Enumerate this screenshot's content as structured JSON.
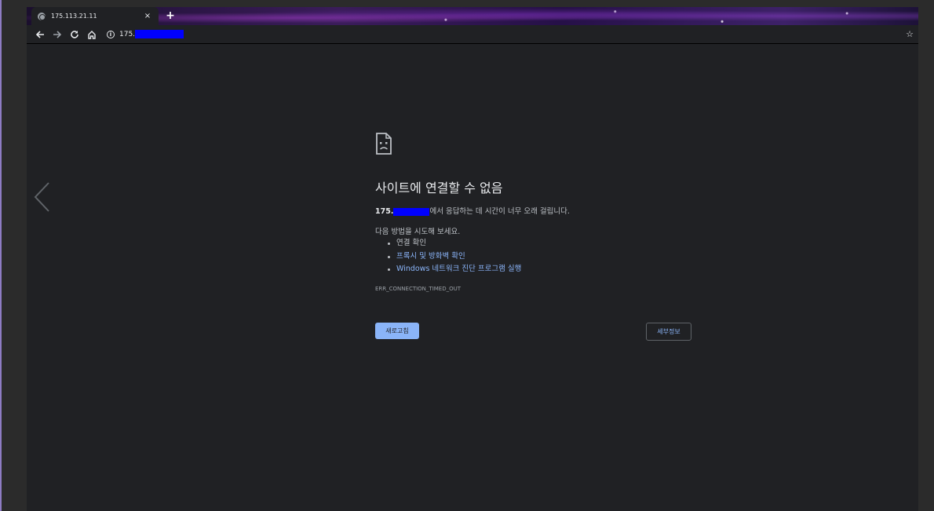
{
  "tab": {
    "title": "175.113.21.11",
    "close_glyph": "×",
    "favicon": "globe-icon"
  },
  "new_tab_glyph": "+",
  "toolbar": {
    "back_icon": "back-arrow-icon",
    "forward_icon": "forward-arrow-icon",
    "reload_icon": "reload-icon",
    "home_icon": "home-icon",
    "info_icon": "info-icon",
    "url_visible": "175.",
    "star_glyph": "☆"
  },
  "error_page": {
    "headline": "사이트에 연결할 수 없음",
    "host_prefix": "175.",
    "description_suffix": "에서 응답하는 데 시간이 너무 오래 걸립니다.",
    "try_label": "다음 방법을 시도해 보세요.",
    "suggestions": [
      "연결 확인",
      "프록시 및 방화벽 확인",
      "Windows 네트워크 진단 프로그램 실행"
    ],
    "error_code": "ERR_CONNECTION_TIMED_OUT",
    "reload_label": "새로고침",
    "details_label": "세부정보"
  },
  "colors": {
    "background": "#202124",
    "link": "#8ab4f8",
    "redaction": "#0000ff"
  }
}
